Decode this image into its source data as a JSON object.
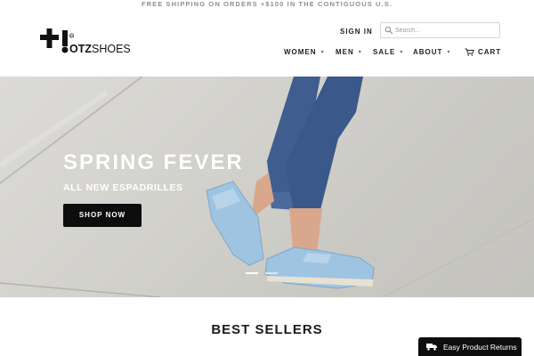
{
  "announcement": "FREE SHIPPING ON ORDERS +$100 IN THE CONTIGUOUS U.S.",
  "brand": {
    "logo_text": "OTZSHOES"
  },
  "header": {
    "signin": "SIGN IN",
    "search_placeholder": "Search...",
    "nav": [
      {
        "label": "WOMEN",
        "has_dropdown": true
      },
      {
        "label": "MEN",
        "has_dropdown": true
      },
      {
        "label": "SALE",
        "has_dropdown": true
      },
      {
        "label": "ABOUT",
        "has_dropdown": true
      }
    ],
    "cart": "CART"
  },
  "hero": {
    "title": "SPRING FEVER",
    "subtitle": "ALL NEW ESPADRILLES",
    "cta": "SHOP NOW",
    "slides": 2,
    "active_slide": 1
  },
  "section_title": "BEST SELLERS",
  "returns_badge": "Easy Product Returns",
  "colors": {
    "button_bg": "#0d0d0d",
    "shoe": "#9ec4e2",
    "jeans": "#3f5e8f"
  }
}
